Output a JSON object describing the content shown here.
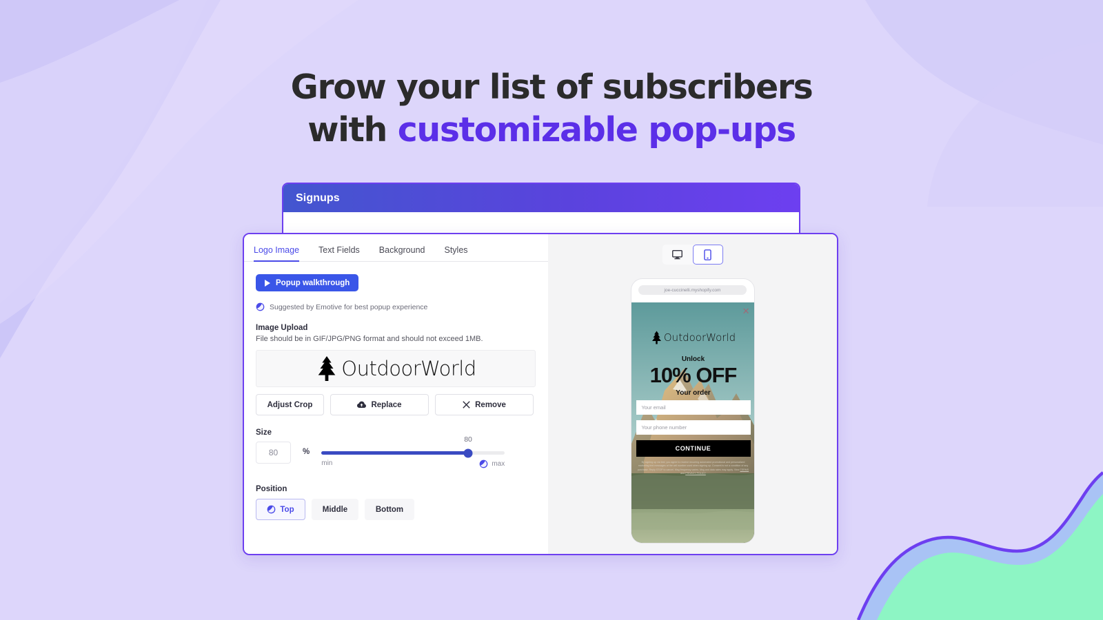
{
  "headline": {
    "line1": "Grow your list of subscribers",
    "line2_prefix": "with ",
    "line2_accent": "customizable pop-ups"
  },
  "colors": {
    "page_background": "#ddd6fb",
    "accent_purple": "#5b2fe8",
    "brand_blue": "#3a56e8",
    "card_border": "#6d3ff0",
    "blob_green": "#8df5c4",
    "blob_blue": "#aac4f5",
    "slider_fill": "#3a4bc2"
  },
  "signups_window": {
    "title": "Signups"
  },
  "editor": {
    "tabs": [
      {
        "label": "Logo Image",
        "active": true
      },
      {
        "label": "Text Fields",
        "active": false
      },
      {
        "label": "Background",
        "active": false
      },
      {
        "label": "Styles",
        "active": false
      }
    ],
    "walkthrough_button": {
      "label": "Popup walkthrough",
      "icon": "play-icon"
    },
    "suggestion": {
      "text": "Suggested by Emotive for best popup experience",
      "icon": "emotive-brand-icon"
    },
    "image_upload": {
      "title": "Image Upload",
      "description": "File should be in GIF/JPG/PNG format and should not exceed 1MB.",
      "logo_text": "OutdoorWorld",
      "logo_icon": "pine-tree-icon",
      "actions": [
        {
          "label": "Adjust Crop",
          "icon": null
        },
        {
          "label": "Replace",
          "icon": "cloud-upload-icon"
        },
        {
          "label": "Remove",
          "icon": "x-icon"
        }
      ]
    },
    "size": {
      "label": "Size",
      "value": "80",
      "unit": "%",
      "slider_value": 80,
      "slider_label": "80",
      "min_label": "min",
      "max_label": "max",
      "max_icon": "emotive-brand-icon"
    },
    "position": {
      "label": "Position",
      "options": [
        {
          "label": "Top",
          "active": true,
          "icon": "emotive-brand-icon"
        },
        {
          "label": "Middle",
          "active": false,
          "icon": null
        },
        {
          "label": "Bottom",
          "active": false,
          "icon": null
        }
      ]
    }
  },
  "preview": {
    "device_toggle": [
      {
        "name": "desktop",
        "icon": "monitor-icon",
        "active": false
      },
      {
        "name": "mobile",
        "icon": "phone-icon",
        "active": true
      }
    ],
    "phone": {
      "url": "joe-cuccinelli.myshopify.com",
      "popup": {
        "close_icon": "x-icon",
        "logo_text": "OutdoorWorld",
        "logo_icon": "pine-tree-icon",
        "eyebrow": "Unlock",
        "headline": "10% OFF",
        "subhead": "Your order",
        "email_placeholder": "Your email",
        "phone_placeholder": "Your phone number",
        "cta_label": "CONTINUE",
        "fine_print_prefix": "By signing up via text, you agree to receive recurring automated promotional and personalized marketing text messages at the cell number used when signing up. Consent is not a condition of any purchase. Reply STOP to cancel. Msg frequency varies. Msg and data rates may apply. View ",
        "fine_print_terms": "TERMS",
        "fine_print_and": " and ",
        "fine_print_privacy": "PRIVACY POLICY"
      }
    }
  }
}
